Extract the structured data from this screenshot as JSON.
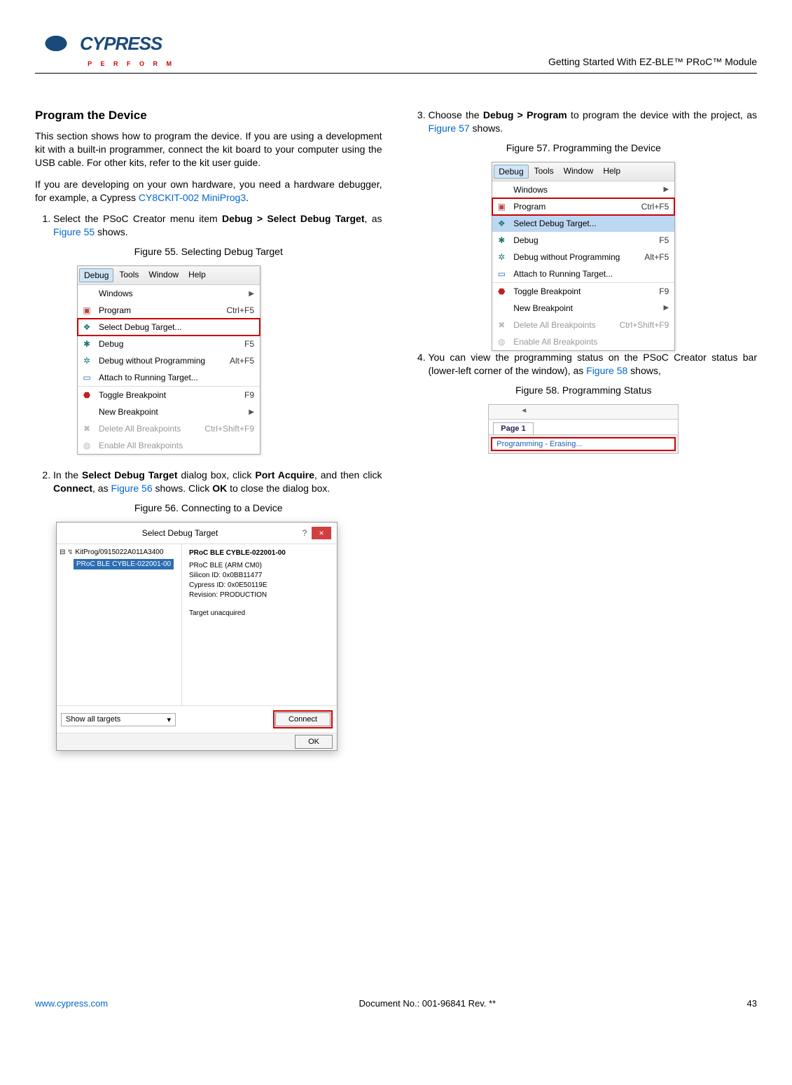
{
  "header": {
    "logo_name": "CYPRESS",
    "logo_tag": "P E R F O R M",
    "doc_title": "Getting Started With EZ-BLE™ PRoC™ Module"
  },
  "section_heading": "Program the Device",
  "intro": "This section shows how to program the device. If you are using a development kit with a built-in programmer, connect the kit board to your computer using the USB cable. For other kits, refer to the kit user guide.",
  "para_hw_pre": "If you are developing on your own hardware, you need a hardware debugger, for example, a Cypress ",
  "link_miniprog": "CY8CKIT-002 MiniProg3",
  "para_hw_post": ".",
  "step1_pre": "Select the PSoC Creator menu item ",
  "step1_bold": "Debug > Select Debug Target",
  "step1_mid": ", as ",
  "step1_link": "Figure 55",
  "step1_post": " shows.",
  "fig55_cap": "Figure 55. Selecting Debug Target",
  "menu": {
    "bar": [
      "Debug",
      "Tools",
      "Window",
      "Help"
    ],
    "items": [
      {
        "label": "Windows",
        "shortcut": "",
        "arrow": true
      },
      {
        "label": "Program",
        "shortcut": "Ctrl+F5"
      },
      {
        "label": "Select Debug Target...",
        "shortcut": ""
      },
      {
        "label": "Debug",
        "shortcut": "F5"
      },
      {
        "label": "Debug without Programming",
        "shortcut": "Alt+F5"
      },
      {
        "label": "Attach to Running Target...",
        "shortcut": ""
      },
      {
        "label": "Toggle Breakpoint",
        "shortcut": "F9"
      },
      {
        "label": "New Breakpoint",
        "shortcut": "",
        "arrow": true
      },
      {
        "label": "Delete All Breakpoints",
        "shortcut": "Ctrl+Shift+F9",
        "disabled": true
      },
      {
        "label": "Enable All Breakpoints",
        "shortcut": "",
        "disabled": true
      }
    ]
  },
  "step2_pre": "In the ",
  "step2_b1": "Select Debug Target",
  "step2_mid1": " dialog box, click ",
  "step2_b2": "Port Acquire",
  "step2_mid2": ", and then click ",
  "step2_b3": "Connect",
  "step2_mid3": ", as ",
  "step2_link": "Figure 56",
  "step2_mid4": " shows. Click ",
  "step2_b4": "OK",
  "step2_post": " to close the dialog box.",
  "fig56_cap": "Figure 56. Connecting to a Device",
  "dialog": {
    "title": "Select Debug Target",
    "tree_parent": "KitProg/0915022A011A3400",
    "tree_child": "PRoC BLE CYBLE-022001-00",
    "right_heading": "PRoC BLE CYBLE-022001-00",
    "right_lines": [
      "PRoC BLE (ARM CM0)",
      "Silicon ID: 0x0BB11477",
      "Cypress ID: 0x0E50119E",
      "Revision: PRODUCTION"
    ],
    "right_status": "Target unacquired",
    "dropdown": "Show all targets",
    "connect": "Connect",
    "ok": "OK"
  },
  "step3_pre": "Choose the ",
  "step3_bold": "Debug > Program",
  "step3_mid": " to program the device with the project, as ",
  "step3_link": "Figure 57",
  "step3_post": " shows.",
  "fig57_cap": "Figure 57. Programming the Device",
  "step4_pre": "You can view the programming status on the PSoC Creator status bar (lower-left corner of the window), as ",
  "step4_link": "Figure 58",
  "step4_post": " shows,",
  "fig58_cap": "Figure 58. Programming Status",
  "status": {
    "tab": "Page 1",
    "msg": "Programming - Erasing..."
  },
  "footer": {
    "url": "www.cypress.com",
    "docno": "Document No.: 001-96841 Rev. **",
    "page": "43"
  }
}
